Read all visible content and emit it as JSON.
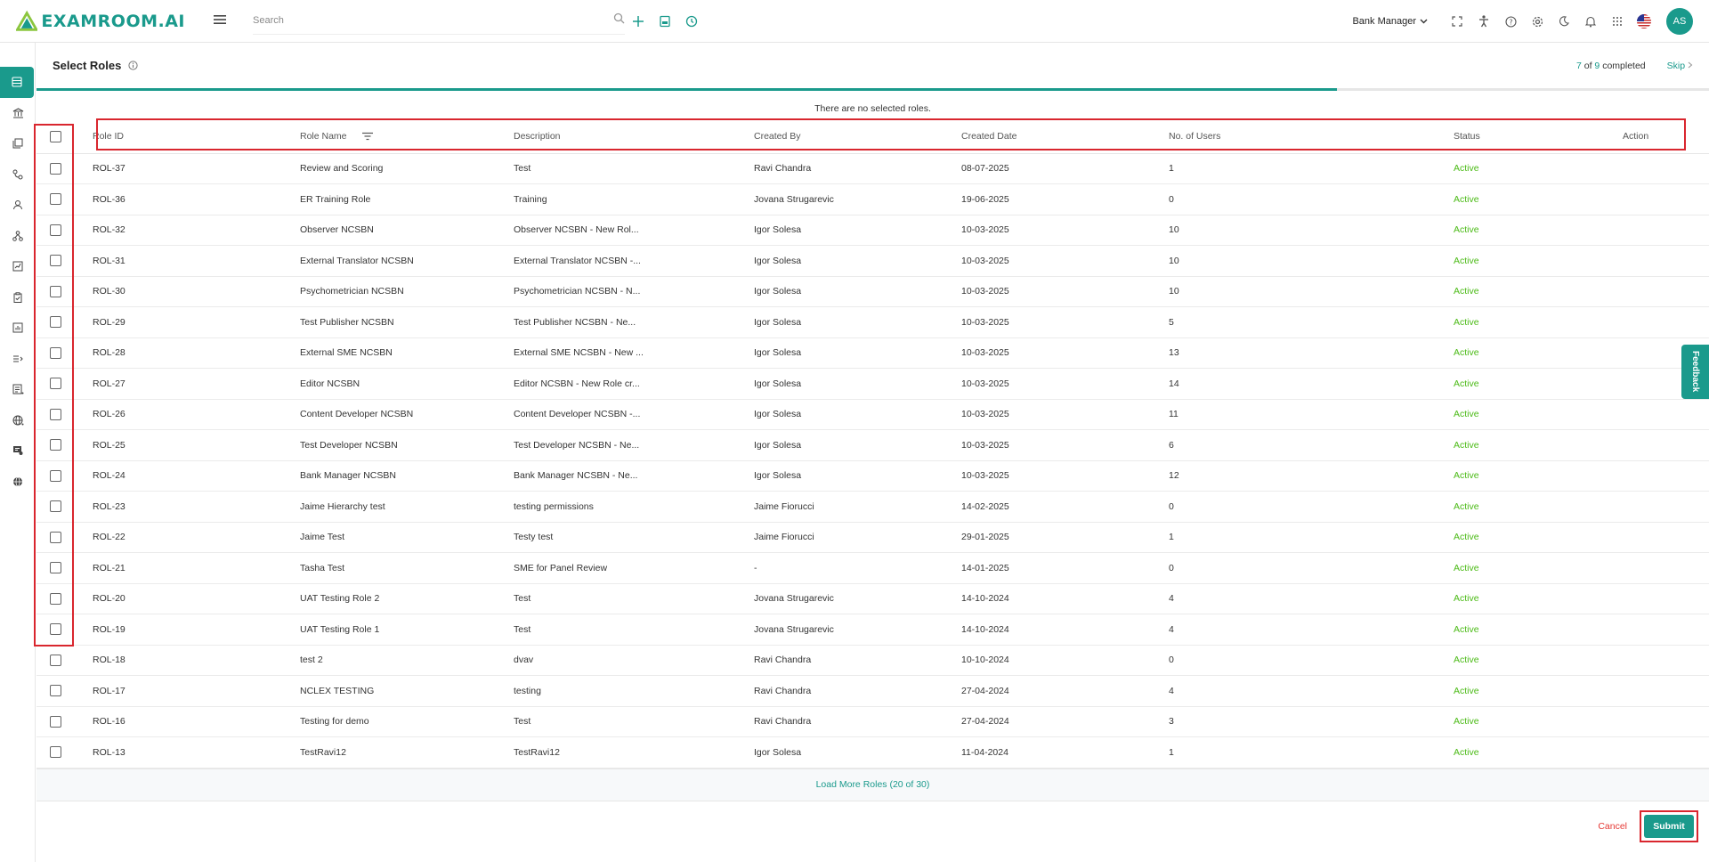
{
  "app": {
    "logo_text": "EXAMROOM.AI"
  },
  "topbar": {
    "search_placeholder": "Search",
    "role_selector": "Bank Manager",
    "avatar_initials": "AS"
  },
  "page": {
    "title": "Select Roles",
    "progress_current": "7",
    "progress_of": "of",
    "progress_total": "9",
    "progress_suffix": "completed",
    "progress_fraction": 0.7778,
    "skip_label": "Skip",
    "empty_message": "There are no selected roles."
  },
  "table": {
    "headers": [
      "Role ID",
      "Role Name",
      "Description",
      "Created By",
      "Created Date",
      "No. of Users",
      "Status",
      "Action"
    ],
    "rows": [
      [
        "ROL-37",
        "Review and Scoring",
        "Test",
        "Ravi Chandra",
        "08-07-2025",
        "1",
        "Active"
      ],
      [
        "ROL-36",
        "ER Training Role",
        "Training",
        "Jovana Strugarevic",
        "19-06-2025",
        "0",
        "Active"
      ],
      [
        "ROL-32",
        "Observer NCSBN",
        "Observer NCSBN - New Rol...",
        "Igor Solesa",
        "10-03-2025",
        "10",
        "Active"
      ],
      [
        "ROL-31",
        "External Translator NCSBN",
        "External Translator NCSBN -...",
        "Igor Solesa",
        "10-03-2025",
        "10",
        "Active"
      ],
      [
        "ROL-30",
        "Psychometrician NCSBN",
        "Psychometrician NCSBN - N...",
        "Igor Solesa",
        "10-03-2025",
        "10",
        "Active"
      ],
      [
        "ROL-29",
        "Test Publisher NCSBN",
        "Test Publisher NCSBN - Ne...",
        "Igor Solesa",
        "10-03-2025",
        "5",
        "Active"
      ],
      [
        "ROL-28",
        "External SME NCSBN",
        "External SME NCSBN - New ...",
        "Igor Solesa",
        "10-03-2025",
        "13",
        "Active"
      ],
      [
        "ROL-27",
        "Editor NCSBN",
        "Editor NCSBN - New Role cr...",
        "Igor Solesa",
        "10-03-2025",
        "14",
        "Active"
      ],
      [
        "ROL-26",
        "Content Developer NCSBN",
        "Content Developer NCSBN -...",
        "Igor Solesa",
        "10-03-2025",
        "11",
        "Active"
      ],
      [
        "ROL-25",
        "Test Developer NCSBN",
        "Test Developer NCSBN - Ne...",
        "Igor Solesa",
        "10-03-2025",
        "6",
        "Active"
      ],
      [
        "ROL-24",
        "Bank Manager NCSBN",
        "Bank Manager NCSBN - Ne...",
        "Igor Solesa",
        "10-03-2025",
        "12",
        "Active"
      ],
      [
        "ROL-23",
        "Jaime Hierarchy test",
        "testing permissions",
        "Jaime Fiorucci",
        "14-02-2025",
        "0",
        "Active"
      ],
      [
        "ROL-22",
        "Jaime Test",
        "Testy test",
        "Jaime Fiorucci",
        "29-01-2025",
        "1",
        "Active"
      ],
      [
        "ROL-21",
        "Tasha Test",
        "SME for Panel Review",
        "-",
        "14-01-2025",
        "0",
        "Active"
      ],
      [
        "ROL-20",
        "UAT Testing Role 2",
        "Test",
        "Jovana Strugarevic",
        "14-10-2024",
        "4",
        "Active"
      ],
      [
        "ROL-19",
        "UAT Testing Role 1",
        "Test",
        "Jovana Strugarevic",
        "14-10-2024",
        "4",
        "Active"
      ],
      [
        "ROL-18",
        "test 2",
        "dvav",
        "Ravi Chandra",
        "10-10-2024",
        "0",
        "Active"
      ],
      [
        "ROL-17",
        "NCLEX TESTING",
        "testing",
        "Ravi Chandra",
        "27-04-2024",
        "4",
        "Active"
      ],
      [
        "ROL-16",
        "Testing for demo",
        "Test",
        "Ravi Chandra",
        "27-04-2024",
        "3",
        "Active"
      ],
      [
        "ROL-13",
        "TestRavi12",
        "TestRavi12",
        "Igor Solesa",
        "11-04-2024",
        "1",
        "Active"
      ]
    ],
    "load_more": "Load More Roles (20 of 30)"
  },
  "footer": {
    "cancel_label": "Cancel",
    "submit_label": "Submit"
  },
  "feedback_label": "Feedback",
  "colors": {
    "accent": "#1a9a8c",
    "status_active": "#4cbb17",
    "cancel": "#e53935",
    "highlight": "#d9262e"
  },
  "sidebar_icons": [
    "list-icon",
    "bank-icon",
    "question-bank-icon",
    "workflow-icon",
    "user-icon",
    "hierarchy-icon",
    "chart-edit-icon",
    "clipboard-check-icon",
    "report-icon",
    "list-arrow-icon",
    "document-list-icon",
    "globe-icon",
    "certificate-icon",
    "language-icon"
  ]
}
